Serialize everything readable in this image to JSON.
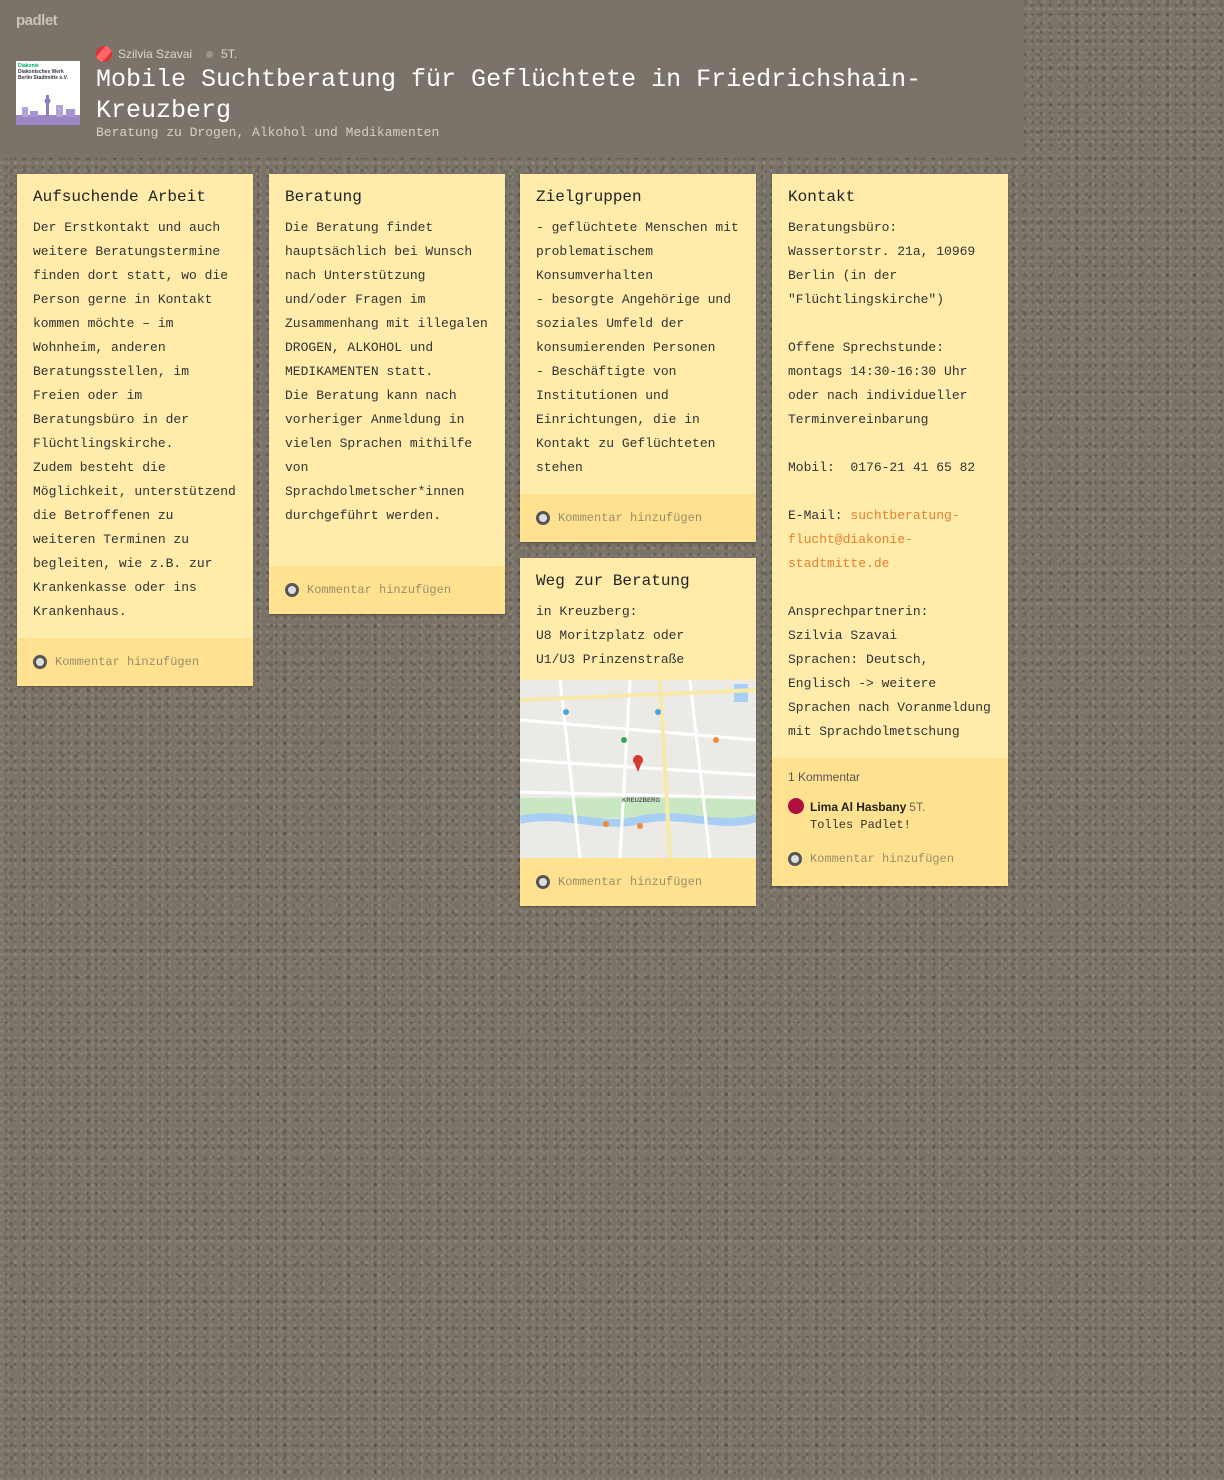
{
  "brand": "padlet",
  "header": {
    "author": "Szilvia Szavai",
    "time": "5T.",
    "title": "Mobile Suchtberatung für Geflüchtete in Friedrichshain-Kreuzberg",
    "subtitle": "Beratung zu Drogen, Alkohol und Medikamenten",
    "logo_line1": "Diakonie",
    "logo_line2": "Diakonisches Werk Berlin Stadtmitte e.V."
  },
  "cards": {
    "aufsuchende": {
      "title": "Aufsuchende Arbeit",
      "body": "Der Erstkontakt und auch weitere Beratungstermine finden dort statt, wo die Person gerne in Kontakt kommen möchte – im Wohnheim, anderen Beratungsstellen, im Freien oder im Beratungsbüro in der Flüchtlingskirche.\nZudem besteht die Möglichkeit, unterstützend die Betroffenen zu weiteren Terminen zu begleiten, wie z.B. zur Krankenkasse oder ins Krankenhaus.",
      "comment_label": "Kommentar hinzufügen"
    },
    "beratung": {
      "title": "Beratung",
      "body": "Die Beratung findet hauptsächlich bei Wunsch nach Unterstützung und/oder Fragen im Zusammenhang mit illegalen DROGEN, ALKOHOL und MEDIKAMENTEN statt.\nDie Beratung kann nach vorheriger Anmeldung in vielen Sprachen mithilfe von Sprachdolmetscher*innen durchgeführt werden.",
      "comment_label": "Kommentar hinzufügen"
    },
    "zielgruppen": {
      "title": "Zielgruppen",
      "body": "- geflüchtete Menschen mit problematischem Konsumverhalten\n- besorgte Angehörige und soziales Umfeld der konsumierenden Personen\n- Beschäftigte von Institutionen und Einrichtungen, die in Kontakt zu Geflüchteten stehen",
      "comment_label": "Kommentar hinzufügen"
    },
    "weg": {
      "title": "Weg zur Beratung",
      "body": "in Kreuzberg:\nU8 Moritzplatz oder\nU1/U3 Prinzenstraße",
      "map_label": "KREUZBERG",
      "comment_label": "Kommentar hinzufügen"
    },
    "kontakt": {
      "title": "Kontakt",
      "body_part1": "Beratungsbüro:\nWassertorstr. 21a, 10969 Berlin (in der \"Flüchtlingskirche\")\n\nOffene Sprechstunde:\nmontags 14:30-16:30 Uhr oder nach individueller Terminvereinbarung\n\nMobil:  0176-21 41 65 82\n\nE-Mail: ",
      "email": "suchtberatung-flucht@diakonie-stadtmitte.de",
      "body_part2": "\n\nAnsprechpartnerin:\nSzilvia Szavai\nSprachen: Deutsch, Englisch -> weitere Sprachen nach Voranmeldung mit Sprachdolmetschung",
      "comment_count": "1 Kommentar",
      "comment_author": "Lima Al Hasbany",
      "comment_time": "5T.",
      "comment_text": "Tolles Padlet!",
      "comment_label": "Kommentar hinzufügen"
    }
  },
  "colors": {
    "card": "#ffebaa",
    "card_footer": "#ffe18f",
    "header": "#7b7369",
    "link": "#e8812c"
  }
}
